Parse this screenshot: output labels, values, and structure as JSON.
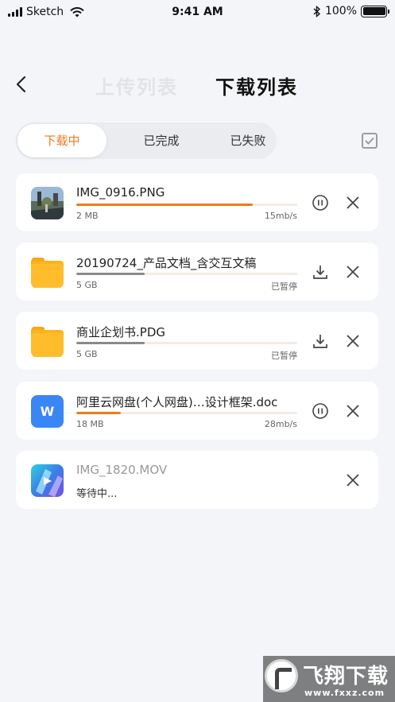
{
  "status_bar": {
    "carrier": "Sketch",
    "time": "9:41 AM",
    "battery": "100%"
  },
  "header": {
    "upload_tab": "上传列表",
    "download_tab": "下载列表"
  },
  "segments": {
    "downloading": "下载中",
    "completed": "已完成",
    "failed": "已失败"
  },
  "colors": {
    "accent": "#f07a1c",
    "paused_bar": "#8a8a8a",
    "word_icon": "#3a86f5",
    "folder": "#ffb31a"
  },
  "items": [
    {
      "name": "IMG_0916.PNG",
      "size": "2 MB",
      "status": "15mb/s",
      "progress": 0.8,
      "state": "downloading",
      "icon": "image-thumbnail-icon"
    },
    {
      "name": "20190724_产品文档_含交互文稿",
      "size": "5 GB",
      "status": "已暂停",
      "progress": 0.31,
      "state": "paused",
      "icon": "folder-icon"
    },
    {
      "name": "商业企划书.PDG",
      "size": "5 GB",
      "status": "已暂停",
      "progress": 0.31,
      "state": "paused",
      "icon": "folder-icon"
    },
    {
      "name": "阿里云网盘(个人网盘)…设计框架.doc",
      "size": "18 MB",
      "status": "28mb/s",
      "progress": 0.2,
      "state": "downloading",
      "icon": "word-doc-icon",
      "icon_letter": "W"
    },
    {
      "name": "IMG_1820.MOV",
      "waiting": "等待中...",
      "state": "waiting",
      "icon": "video-thumbnail-icon"
    }
  ],
  "watermark": {
    "title": "飞翔下载",
    "url": "www.fxxz.com"
  }
}
